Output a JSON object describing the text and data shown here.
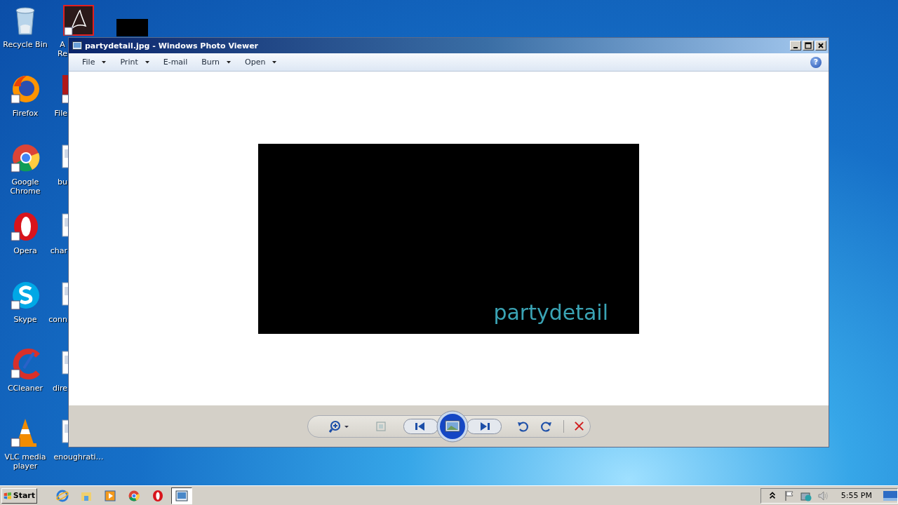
{
  "desktop": {
    "icons": [
      {
        "kind": "recycle-bin",
        "label": "Recycle Bin",
        "clipped": false
      },
      {
        "kind": "firefox",
        "label": "Firefox",
        "clipped": false
      },
      {
        "kind": "chrome",
        "label": "Google Chrome",
        "clipped": false
      },
      {
        "kind": "opera",
        "label": "Opera",
        "clipped": false
      },
      {
        "kind": "skype",
        "label": "Skype",
        "clipped": false
      },
      {
        "kind": "ccleaner",
        "label": "CCleaner",
        "clipped": false
      },
      {
        "kind": "vlc",
        "label": "VLC media player",
        "clipped": false
      },
      {
        "kind": "acrobat",
        "label": "A\nRe",
        "clipped": true
      },
      {
        "kind": "red-file",
        "label": "File",
        "clipped": true
      },
      {
        "kind": "document",
        "label": "bu",
        "clipped": true
      },
      {
        "kind": "document",
        "label": "char",
        "clipped": true
      },
      {
        "kind": "document",
        "label": "conn",
        "clipped": true
      },
      {
        "kind": "document",
        "label": "dire",
        "clipped": true
      },
      {
        "kind": "document",
        "label": "enoughrati…",
        "clipped": false
      },
      {
        "kind": "thumbnail"
      }
    ]
  },
  "window": {
    "title": "partydetail.jpg - Windows Photo Viewer",
    "menu": [
      {
        "label": "File",
        "dropdown": true
      },
      {
        "label": "Print",
        "dropdown": true
      },
      {
        "label": "E-mail",
        "dropdown": false
      },
      {
        "label": "Burn",
        "dropdown": true
      },
      {
        "label": "Open",
        "dropdown": true
      }
    ],
    "help": "?",
    "image_text": "partydetail"
  },
  "taskbar": {
    "start": "Start",
    "apps": [
      {
        "kind": "ie",
        "selected": false
      },
      {
        "kind": "explorer",
        "selected": false
      },
      {
        "kind": "media",
        "selected": false
      },
      {
        "kind": "chrome",
        "selected": false
      },
      {
        "kind": "opera",
        "selected": false
      },
      {
        "kind": "photo-viewer",
        "selected": true
      }
    ],
    "clock": "5:55 PM"
  }
}
